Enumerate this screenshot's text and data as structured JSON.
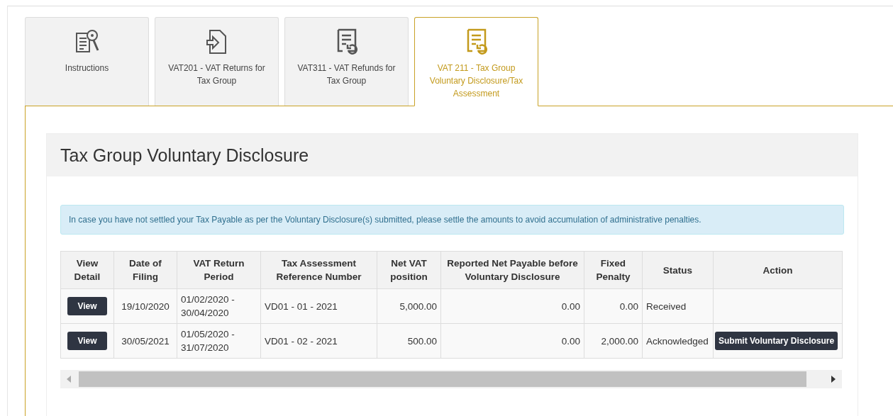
{
  "tabs": [
    {
      "label": "Instructions",
      "kind": "instructions",
      "selected": false
    },
    {
      "label": "VAT201 - VAT Returns for Tax Group",
      "kind": "upload",
      "selected": false
    },
    {
      "label": "VAT311 - VAT Refunds for Tax Group",
      "kind": "refund",
      "selected": false
    },
    {
      "label": "VAT 211 - Tax Group Voluntary Disclosure/Tax Assessment",
      "kind": "refund",
      "selected": true
    }
  ],
  "panel": {
    "title": "Tax Group Voluntary Disclosure",
    "alert": "In case you have not settled your Tax Payable as per the Voluntary Disclosure(s) submitted, please settle the amounts to avoid accumulation of administrative penalties.",
    "table": {
      "columns": [
        "View Detail",
        "Date of Filing",
        "VAT Return Period",
        "Tax Assessment Reference Number",
        "Net VAT position",
        "Reported Net Payable before Voluntary Disclosure",
        "Fixed Penalty",
        "Status",
        "Action"
      ],
      "rows": [
        {
          "view": "View",
          "date": "19/10/2020",
          "period": "01/02/2020 - 30/04/2020",
          "reference": "VD01 - 01 - 2021",
          "net_vat": "5,000.00",
          "reported": "0.00",
          "penalty": "0.00",
          "status": "Received"
        },
        {
          "view": "View",
          "date": "30/05/2021",
          "period": "01/05/2020 - 31/07/2020",
          "reference": "VD01 - 02 - 2021",
          "net_vat": "500.00",
          "reported": "0.00",
          "penalty": "2,000.00",
          "status": "Acknowledged",
          "action": "Submit Voluntary Disclosure"
        }
      ]
    }
  }
}
